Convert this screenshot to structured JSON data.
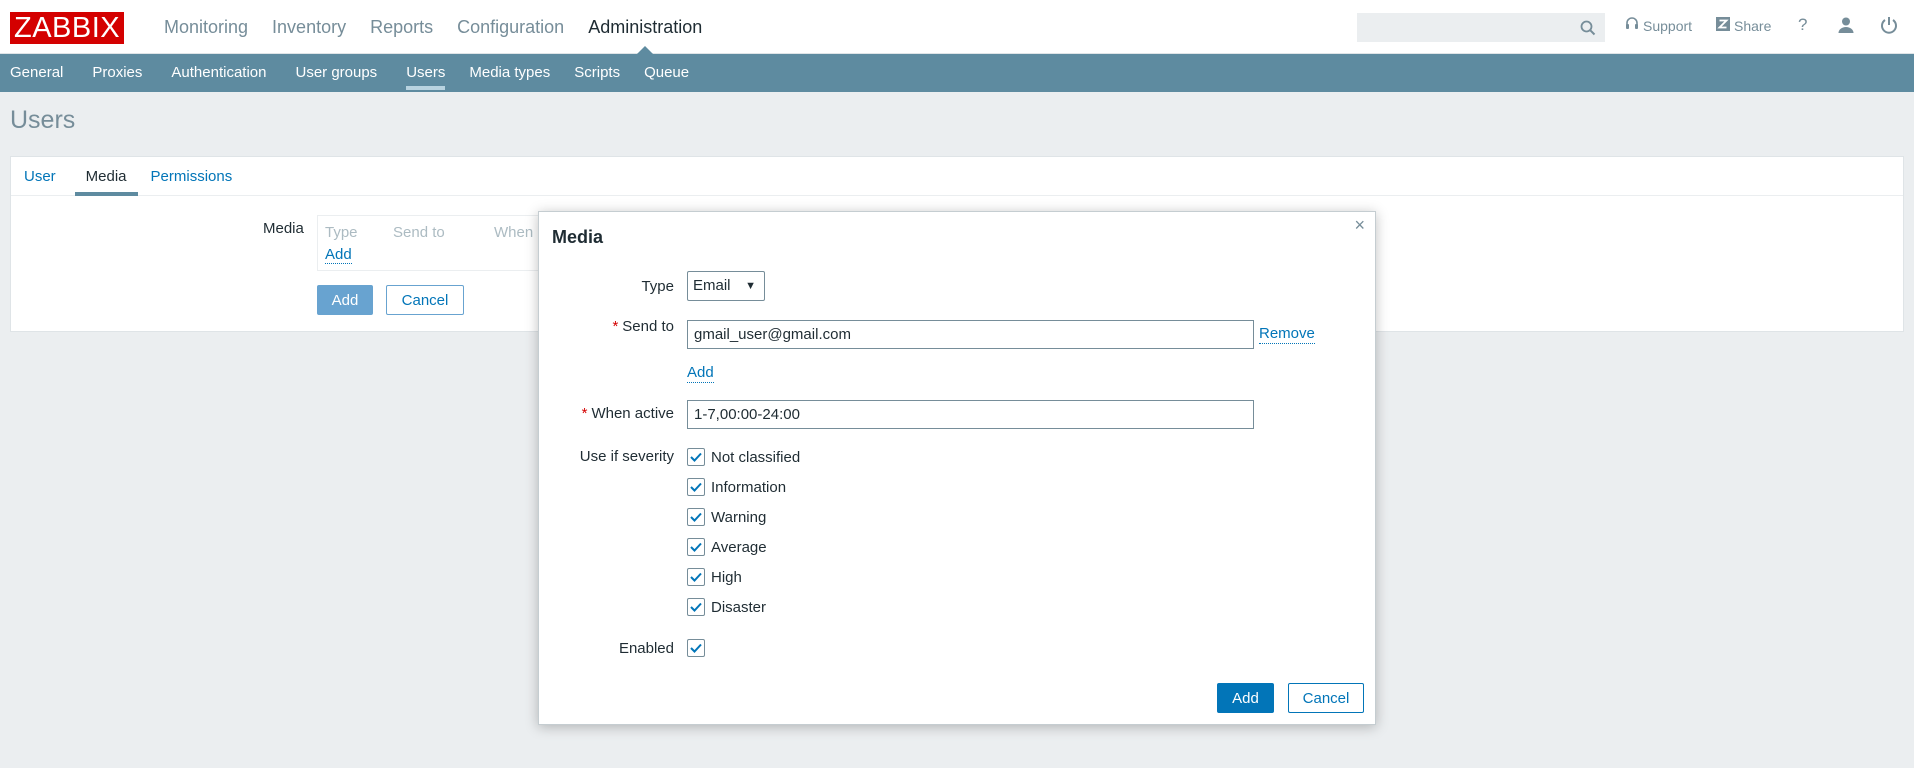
{
  "header": {
    "logo": "ZABBIX",
    "menu": [
      {
        "label": "Monitoring",
        "active": false
      },
      {
        "label": "Inventory",
        "active": false
      },
      {
        "label": "Reports",
        "active": false
      },
      {
        "label": "Configuration",
        "active": false
      },
      {
        "label": "Administration",
        "active": true
      }
    ],
    "search_value": "",
    "support_label": "Support",
    "share_label": "Share",
    "help_label": "?"
  },
  "submenu": [
    {
      "label": "General",
      "active": false
    },
    {
      "label": "Proxies",
      "active": false
    },
    {
      "label": "Authentication",
      "active": false
    },
    {
      "label": "User groups",
      "active": false
    },
    {
      "label": "Users",
      "active": true
    },
    {
      "label": "Media types",
      "active": false
    },
    {
      "label": "Scripts",
      "active": false
    },
    {
      "label": "Queue",
      "active": false
    }
  ],
  "page": {
    "title": "Users",
    "tabs": [
      {
        "label": "User",
        "active": false
      },
      {
        "label": "Media",
        "active": true
      },
      {
        "label": "Permissions",
        "active": false
      }
    ],
    "media_label": "Media",
    "media_table_headers": [
      "Type",
      "Send to",
      "When a"
    ],
    "media_add_link": "Add",
    "add_button": "Add",
    "cancel_button": "Cancel"
  },
  "modal": {
    "title": "Media",
    "close": "×",
    "type_label": "Type",
    "type_value": "Email",
    "send_to_label": "Send to",
    "send_to_value": "gmail_user@gmail.com",
    "remove_link": "Remove",
    "add_link": "Add",
    "when_active_label": "When active",
    "when_active_value": "1-7,00:00-24:00",
    "severity_label": "Use if severity",
    "severities": [
      {
        "label": "Not classified",
        "checked": true
      },
      {
        "label": "Information",
        "checked": true
      },
      {
        "label": "Warning",
        "checked": true
      },
      {
        "label": "Average",
        "checked": true
      },
      {
        "label": "High",
        "checked": true
      },
      {
        "label": "Disaster",
        "checked": true
      }
    ],
    "enabled_label": "Enabled",
    "enabled_checked": true,
    "add_button": "Add",
    "cancel_button": "Cancel"
  },
  "colors": {
    "brand_red": "#d40000",
    "submenu_bg": "#5e8ba0",
    "link_blue": "#0275b8",
    "background": "#ebeef0"
  }
}
